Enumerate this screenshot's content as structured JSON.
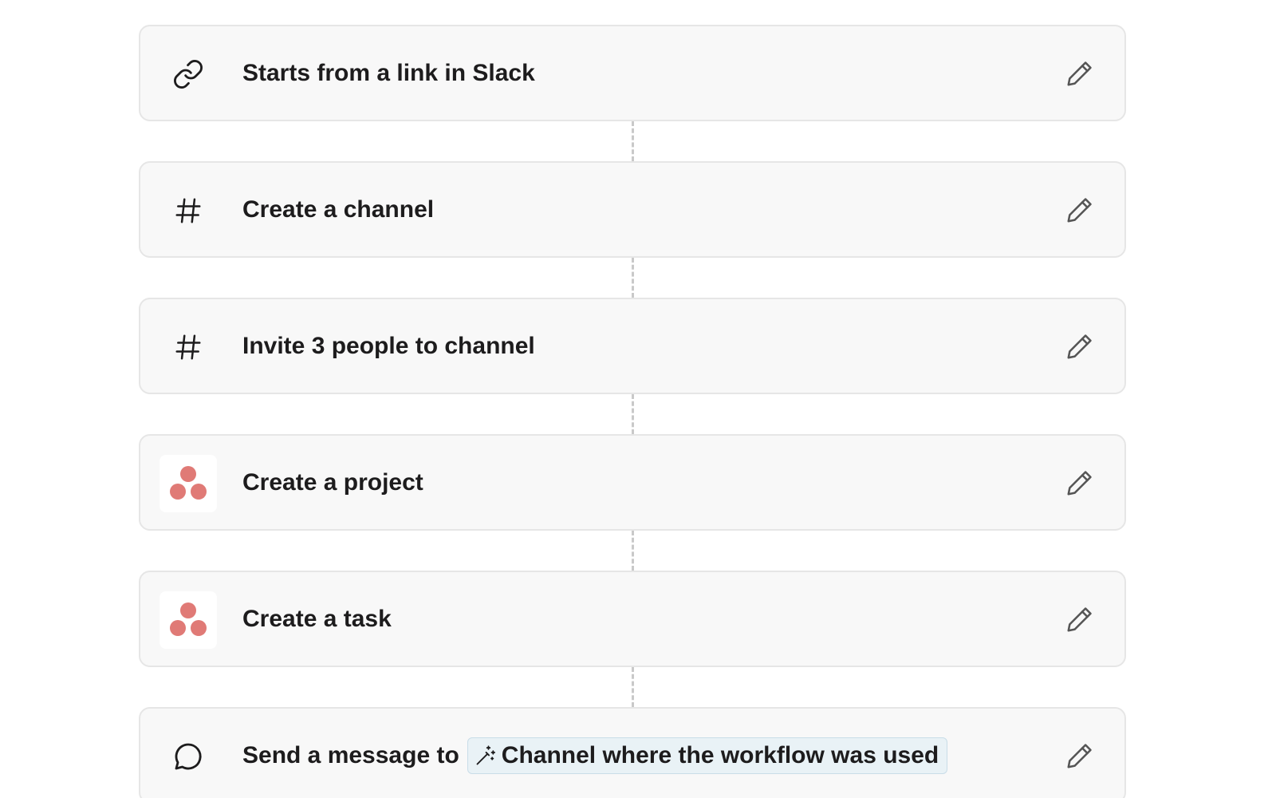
{
  "workflow": {
    "steps": [
      {
        "label": "Starts from a link in Slack",
        "icon": "link-icon"
      },
      {
        "label": "Create a channel",
        "icon": "hash-icon"
      },
      {
        "label": "Invite 3 people to channel",
        "icon": "hash-icon"
      },
      {
        "label": "Create a project",
        "icon": "asana-logo-icon"
      },
      {
        "label": "Create a task",
        "icon": "asana-logo-icon"
      },
      {
        "label": "Send a message to",
        "icon": "message-bubble-icon",
        "token": {
          "label": "Channel where the workflow was used",
          "icon": "magic-wand-icon"
        }
      }
    ],
    "edit_icon": "pencil-icon"
  },
  "colors": {
    "card_background": "#f8f8f8",
    "card_border": "#e6e6e6",
    "text": "#1d1c1d",
    "asana_coral": "#e07a76",
    "token_background": "#e9f2f6",
    "connector": "#c9c9c9"
  }
}
